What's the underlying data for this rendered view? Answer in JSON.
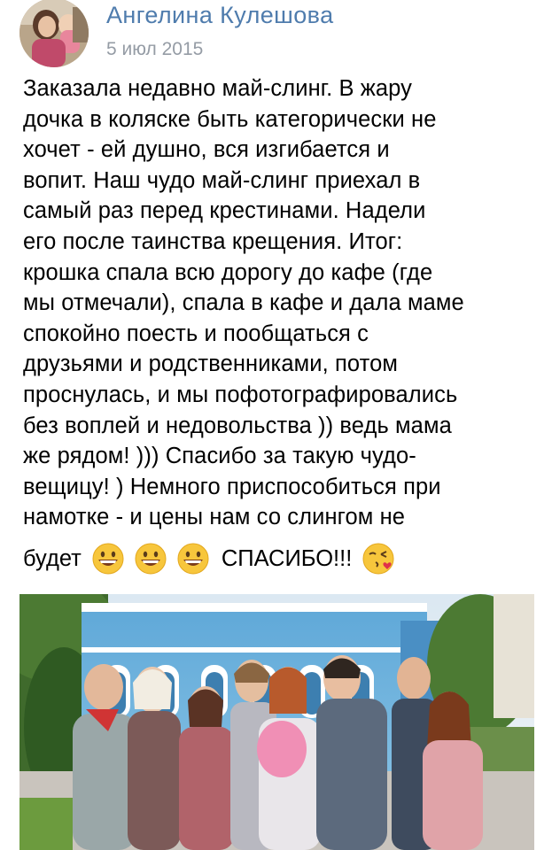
{
  "post": {
    "author_name": "Ангелина Кулешова",
    "date": "5 июл 2015",
    "text_lines": [
      "Заказала недавно май-слинг. В жару",
      "дочка в коляске быть категорически не",
      "хочет - ей душно, вся изгибается и",
      "вопит. Наш чудо май-слинг приехал в",
      "самый раз перед крестинами. Надели",
      "его после таинства крещения. Итог:",
      "крошка спала всю дорогу до кафе (где",
      "мы отмечали), спала в кафе и дала маме",
      "спокойно поесть и пообщаться с",
      "друзьями и родственниками, потом",
      "проснулась, и мы пофотографировались",
      "без воплей и недовольства )) ведь мама",
      "же рядом! ))) Спасибо за такую чудо-",
      "вещицу! ) Немного приспособиться при",
      "намотке - и цены нам со слингом не"
    ],
    "last_line_word": "будет",
    "last_line_thanks": "СПАСИБО!!!",
    "emojis": [
      "grinning-face-icon",
      "grinning-face-icon",
      "grinning-face-icon",
      "face-blowing-kiss-icon"
    ]
  },
  "colors": {
    "author_name": "#4f7cad",
    "date": "#959ca5",
    "text": "#000000"
  }
}
